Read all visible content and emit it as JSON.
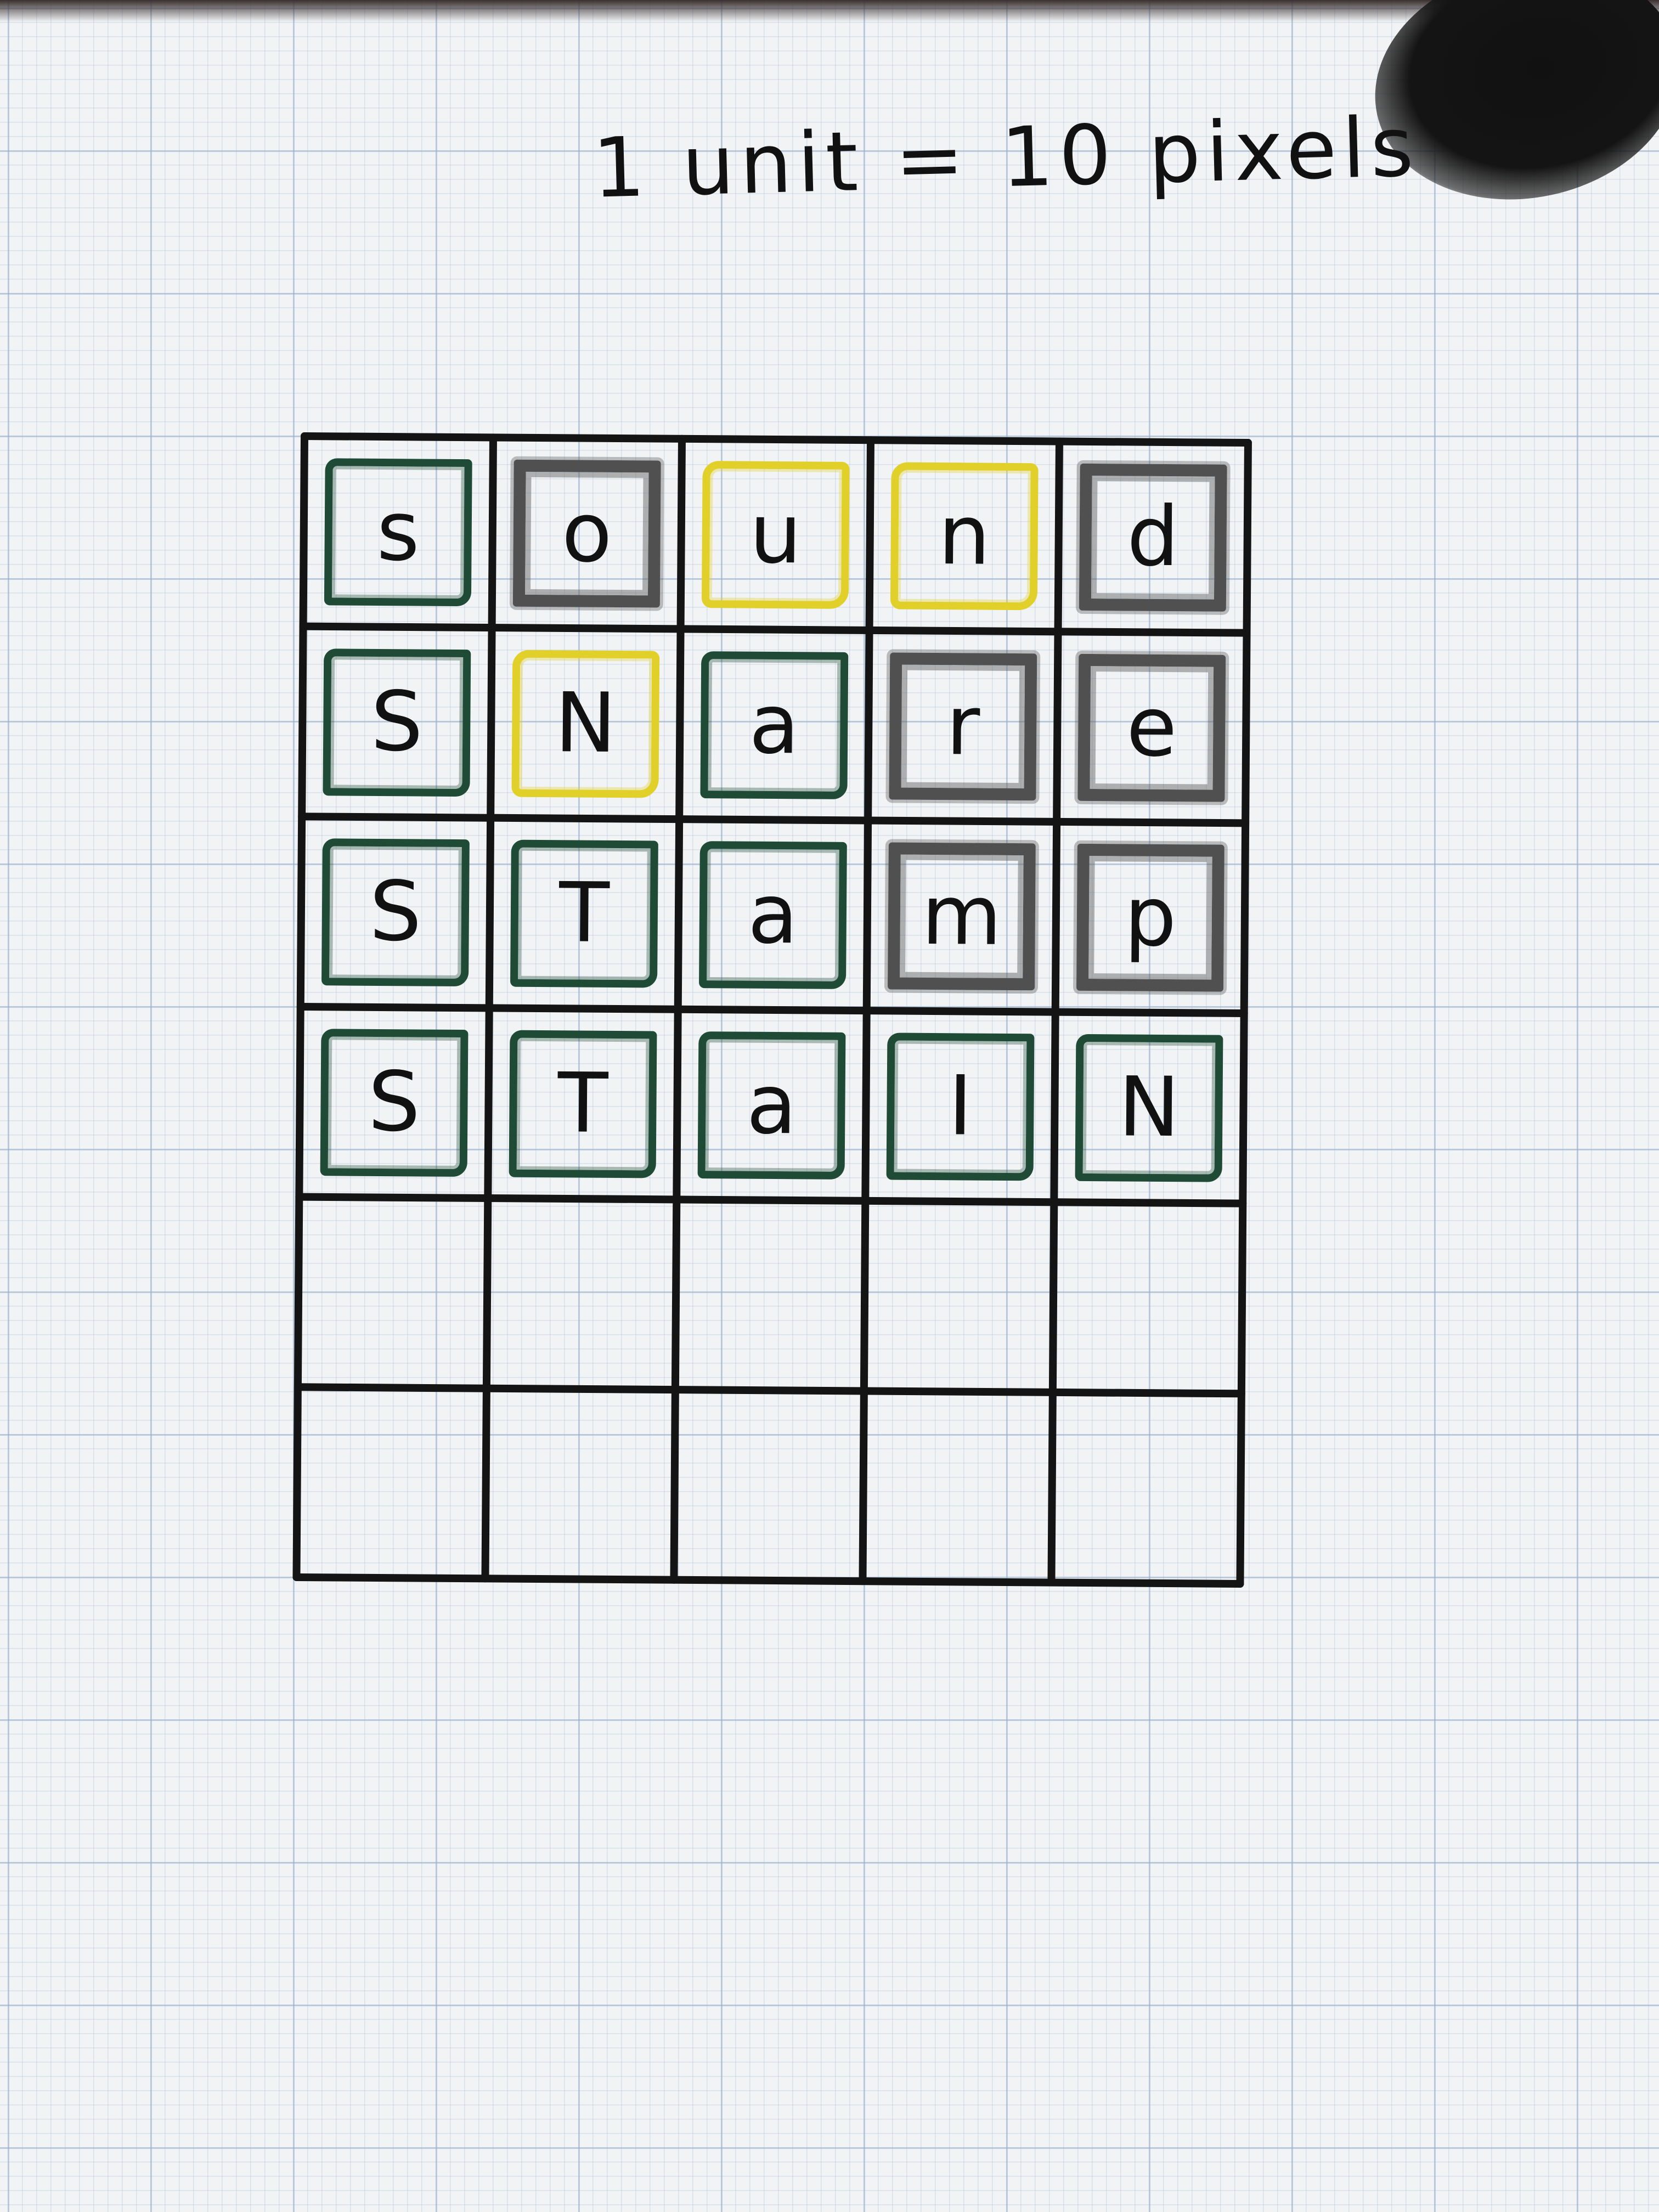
{
  "title": "1 unit = 10 pixels",
  "board": {
    "columns": 5,
    "rows": 6,
    "guesses": [
      {
        "word": "sound",
        "tiles": [
          {
            "letter": "s",
            "state": "green"
          },
          {
            "letter": "o",
            "state": "gray"
          },
          {
            "letter": "u",
            "state": "yellow"
          },
          {
            "letter": "n",
            "state": "yellow"
          },
          {
            "letter": "d",
            "state": "gray"
          }
        ]
      },
      {
        "word": "SNaRE",
        "tiles": [
          {
            "letter": "S",
            "state": "green"
          },
          {
            "letter": "N",
            "state": "yellow"
          },
          {
            "letter": "a",
            "state": "green"
          },
          {
            "letter": "r",
            "state": "gray"
          },
          {
            "letter": "e",
            "state": "gray"
          }
        ]
      },
      {
        "word": "STaMP",
        "tiles": [
          {
            "letter": "S",
            "state": "green"
          },
          {
            "letter": "T",
            "state": "green"
          },
          {
            "letter": "a",
            "state": "green"
          },
          {
            "letter": "m",
            "state": "gray"
          },
          {
            "letter": "p",
            "state": "gray"
          }
        ]
      },
      {
        "word": "STaIN",
        "tiles": [
          {
            "letter": "S",
            "state": "green"
          },
          {
            "letter": "T",
            "state": "green"
          },
          {
            "letter": "a",
            "state": "green"
          },
          {
            "letter": "I",
            "state": "green"
          },
          {
            "letter": "N",
            "state": "green"
          }
        ]
      },
      {
        "word": "",
        "tiles": []
      },
      {
        "word": "",
        "tiles": []
      }
    ]
  },
  "colors": {
    "green": "#1f4a36",
    "yellow": "#e2d02a",
    "gray": "#505050",
    "ink": "#141414"
  }
}
